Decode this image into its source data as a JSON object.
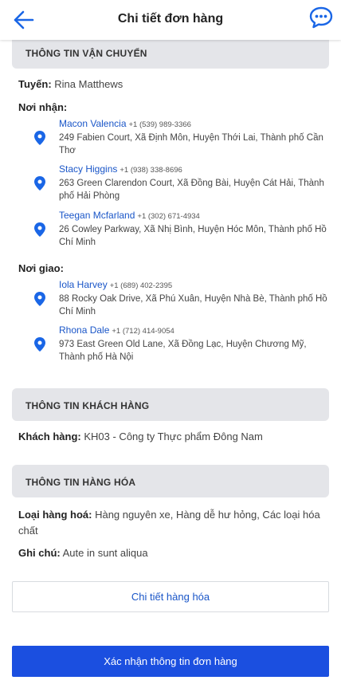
{
  "header": {
    "title": "Chi tiết đơn hàng"
  },
  "shipping": {
    "section_title": "THÔNG TIN VẬN CHUYỂN",
    "route_label": "Tuyến:",
    "route_value": "Rina Matthews",
    "pickup_label": "Nơi nhận:",
    "pickups": [
      {
        "name": "Macon Valencia",
        "phone": "+1 (539) 989-3366",
        "address": "249 Fabien Court, Xã Định Môn, Huyện Thới Lai, Thành phố Cần Thơ"
      },
      {
        "name": "Stacy Higgins",
        "phone": "+1 (938) 338-8696",
        "address": "263 Green Clarendon Court, Xã Đồng Bài, Huyện Cát Hải, Thành phố Hải Phòng"
      },
      {
        "name": "Teegan Mcfarland",
        "phone": "+1 (302) 671-4934",
        "address": "26 Cowley Parkway, Xã Nhị Bình, Huyện Hóc Môn, Thành phố Hồ Chí Minh"
      }
    ],
    "delivery_label": "Nơi giao:",
    "deliveries": [
      {
        "name": "Iola Harvey",
        "phone": "+1 (689) 402-2395",
        "address": "88 Rocky Oak Drive, Xã Phú Xuân, Huyện Nhà Bè, Thành phố Hồ Chí Minh"
      },
      {
        "name": "Rhona Dale",
        "phone": "+1 (712) 414-9054",
        "address": "973 East Green Old Lane, Xã Đồng Lạc, Huyện Chương Mỹ, Thành phố Hà Nội"
      }
    ]
  },
  "customer": {
    "section_title": "THÔNG TIN KHÁCH HÀNG",
    "label": "Khách hàng:",
    "value": "KH03 - Công ty Thực phẩm Đông Nam"
  },
  "goods": {
    "section_title": "THÔNG TIN HÀNG HÓA",
    "type_label": "Loại hàng hoá:",
    "type_value": "Hàng nguyên xe, Hàng dễ hư hỏng, Các loại hóa chất",
    "note_label": "Ghi chú:",
    "note_value": "Aute in sunt aliqua"
  },
  "buttons": {
    "detail": "Chi tiết hàng hóa",
    "confirm": "Xác nhận thông tin đơn hàng"
  },
  "colors": {
    "accent": "#1b4fe0",
    "link": "#1a56c8",
    "section_bg": "#e4e5e9"
  },
  "icons": {
    "back": "arrow-left-icon",
    "chat": "chat-bubble-icon",
    "pin": "map-pin-icon"
  }
}
